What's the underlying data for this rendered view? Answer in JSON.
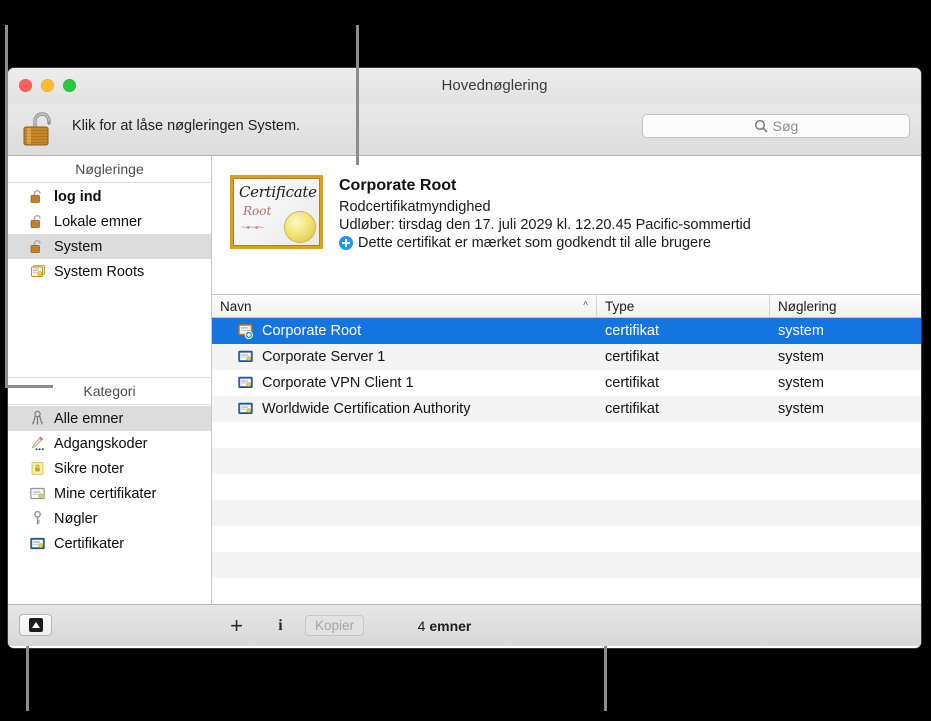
{
  "window": {
    "title": "Hovednøglering",
    "traffic_lights": [
      "close-button",
      "minimize-button",
      "zoom-button"
    ]
  },
  "toolbar": {
    "lock_icon": "open-padlock-icon",
    "lock_label": "Klik for at låse nøgleringen System.",
    "search": {
      "icon": "search-icon",
      "placeholder": "Søg",
      "value": ""
    }
  },
  "sidebar": {
    "keychains_header": "Nøgleringe",
    "keychains": [
      {
        "label": "log ind",
        "icon": "unlocked-keychain-icon",
        "selected": false,
        "bold": true
      },
      {
        "label": "Lokale emner",
        "icon": "unlocked-keychain-icon",
        "selected": false,
        "bold": false
      },
      {
        "label": "System",
        "icon": "unlocked-keychain-icon",
        "selected": true,
        "bold": false
      },
      {
        "label": "System Roots",
        "icon": "certificate-stack-icon",
        "selected": false,
        "bold": false
      }
    ],
    "category_header": "Kategori",
    "categories": [
      {
        "label": "Alle emner",
        "icon": "keyring-icon",
        "selected": true
      },
      {
        "label": "Adgangskoder",
        "icon": "pencil-password-icon",
        "selected": false
      },
      {
        "label": "Sikre noter",
        "icon": "yellow-lock-note-icon",
        "selected": false
      },
      {
        "label": "Mine certifikater",
        "icon": "my-certificate-icon",
        "selected": false
      },
      {
        "label": "Nøgler",
        "icon": "key-icon",
        "selected": false
      },
      {
        "label": "Certifikater",
        "icon": "certificate-icon",
        "selected": false
      }
    ]
  },
  "detail": {
    "thumbnail": {
      "icon": "certificate-thumbnail-icon",
      "word_certificate": "Certificate",
      "word_root": "Root",
      "flourish": "~•~•~",
      "seal": "gold-seal"
    },
    "name": "Corporate Root",
    "kind": "Rodcertifikatmyndighed",
    "expiry": "Udløber: tirsdag den 17. juli 2029 kl. 12.20.45 Pacific-sommertid",
    "trust_icon": "blue-plus-badge-icon",
    "trust": "Dette certifikat er mærket som godkendt til alle brugere"
  },
  "table": {
    "columns": [
      {
        "label": "Navn",
        "sort_caret": "^"
      },
      {
        "label": "Type",
        "sort_caret": ""
      },
      {
        "label": "Nøglering",
        "sort_caret": ""
      }
    ],
    "rows": [
      {
        "icon": "certificate-root-add-icon",
        "name": "Corporate Root",
        "type": "certifikat",
        "keychain": "system",
        "selected": true
      },
      {
        "icon": "certificate-icon",
        "name": "Corporate Server 1",
        "type": "certifikat",
        "keychain": "system",
        "selected": false
      },
      {
        "icon": "certificate-icon",
        "name": "Corporate VPN Client 1",
        "type": "certifikat",
        "keychain": "system",
        "selected": false
      },
      {
        "icon": "certificate-icon",
        "name": "Worldwide Certification Authority",
        "type": "certifikat",
        "keychain": "system",
        "selected": false
      }
    ],
    "empty_row_count": 7
  },
  "bottom_bar": {
    "sidebar_toggle_icon": "show-hide-sidebar-icon",
    "add_label": "+",
    "info_label": "i",
    "copy_label": "Kopier",
    "count_number": "4",
    "count_word": "emner"
  },
  "colors": {
    "selection_blue": "#1474e0",
    "accent_gold": "#d9a122",
    "background": "#000000",
    "callout_line": "#8c8c8c"
  }
}
